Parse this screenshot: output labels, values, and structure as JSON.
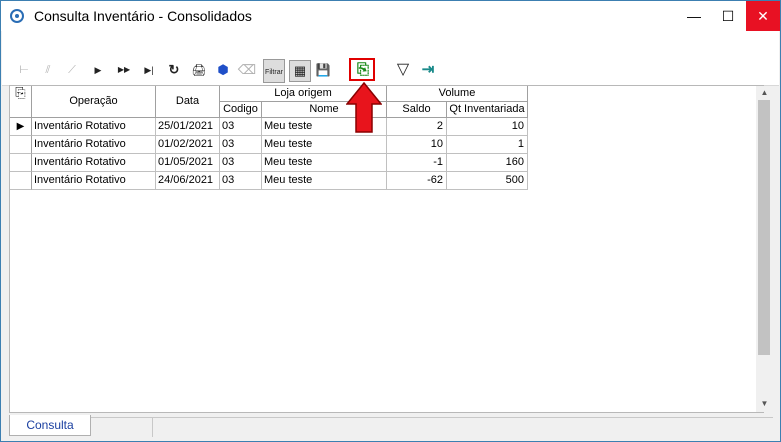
{
  "window": {
    "title": "Consulta Inventário - Consolidados",
    "minimize": "—",
    "maximize": "☐",
    "close": "✕"
  },
  "toolbar": {
    "first": "⊢",
    "prev_page": "⫽",
    "prev": "⟋",
    "next": "▶",
    "next_page": "▶▶",
    "last": "▶|",
    "refresh": "↻",
    "print": "🖨",
    "tag": "⬢",
    "eraser": "⌫",
    "filtrar_label": "Filtrar",
    "graf": "▦",
    "save": "💾",
    "export": "⎘",
    "filter": "▽",
    "exit": "⇥"
  },
  "grid": {
    "headers": {
      "operacao": "Operação",
      "data": "Data",
      "loja_origem": "Loja origem",
      "codigo": "Codigo",
      "nome": "Nome",
      "volume": "Volume",
      "saldo": "Saldo",
      "qt_inventariada": "Qt Inventariada"
    },
    "rows": [
      {
        "operacao": "Inventário Rotativo",
        "data": "25/01/2021",
        "codigo": "03",
        "nome": "Meu teste",
        "saldo": "2",
        "qt": "10"
      },
      {
        "operacao": "Inventário Rotativo",
        "data": "01/02/2021",
        "codigo": "03",
        "nome": "Meu teste",
        "saldo": "10",
        "qt": "1"
      },
      {
        "operacao": "Inventário Rotativo",
        "data": "01/05/2021",
        "codigo": "03",
        "nome": "Meu teste",
        "saldo": "-1",
        "qt": "160"
      },
      {
        "operacao": "Inventário Rotativo",
        "data": "24/06/2021",
        "codigo": "03",
        "nome": "Meu teste",
        "saldo": "-62",
        "qt": "500"
      }
    ]
  },
  "tabs": {
    "consulta": "Consulta"
  },
  "colors": {
    "highlight": "#e00000",
    "arrow": "#e8141c",
    "tab_text": "#1a3fa0"
  }
}
